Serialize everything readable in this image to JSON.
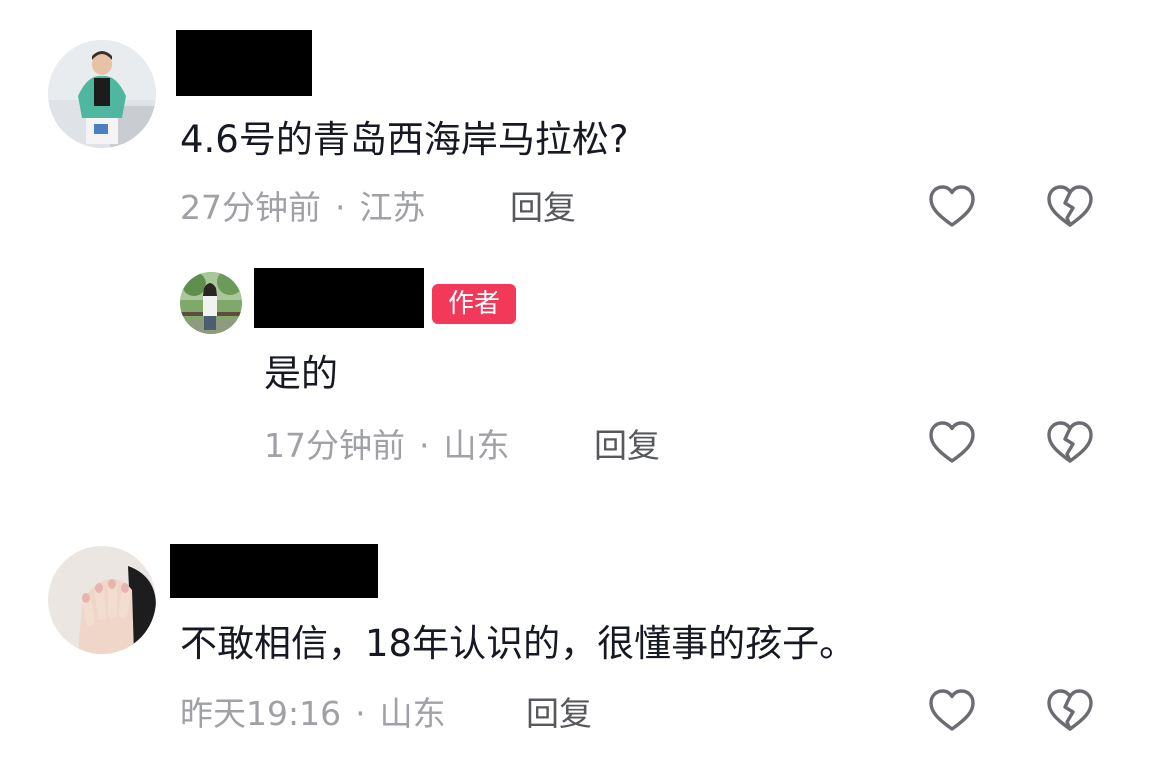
{
  "comments": [
    {
      "text": "4.6号的青岛西海岸马拉松?",
      "time": "27分钟前",
      "separator": "·",
      "location": "江苏",
      "reply_label": "回复"
    },
    {
      "is_reply": true,
      "badge": "作者",
      "text": "是的",
      "time": "17分钟前",
      "separator": "·",
      "location": "山东",
      "reply_label": "回复"
    },
    {
      "text": "不敢相信，18年认识的，很懂事的孩子。",
      "time": "昨天19:16",
      "separator": "·",
      "location": "山东",
      "reply_label": "回复"
    }
  ],
  "icons": {
    "like": "heart-outline-icon",
    "dislike": "broken-heart-icon"
  },
  "colors": {
    "badge_bg": "#f2395a",
    "text_primary": "#161823",
    "text_meta": "#a0a1a6",
    "text_reply": "#57585e",
    "icon_stroke": "#6b6c72"
  }
}
